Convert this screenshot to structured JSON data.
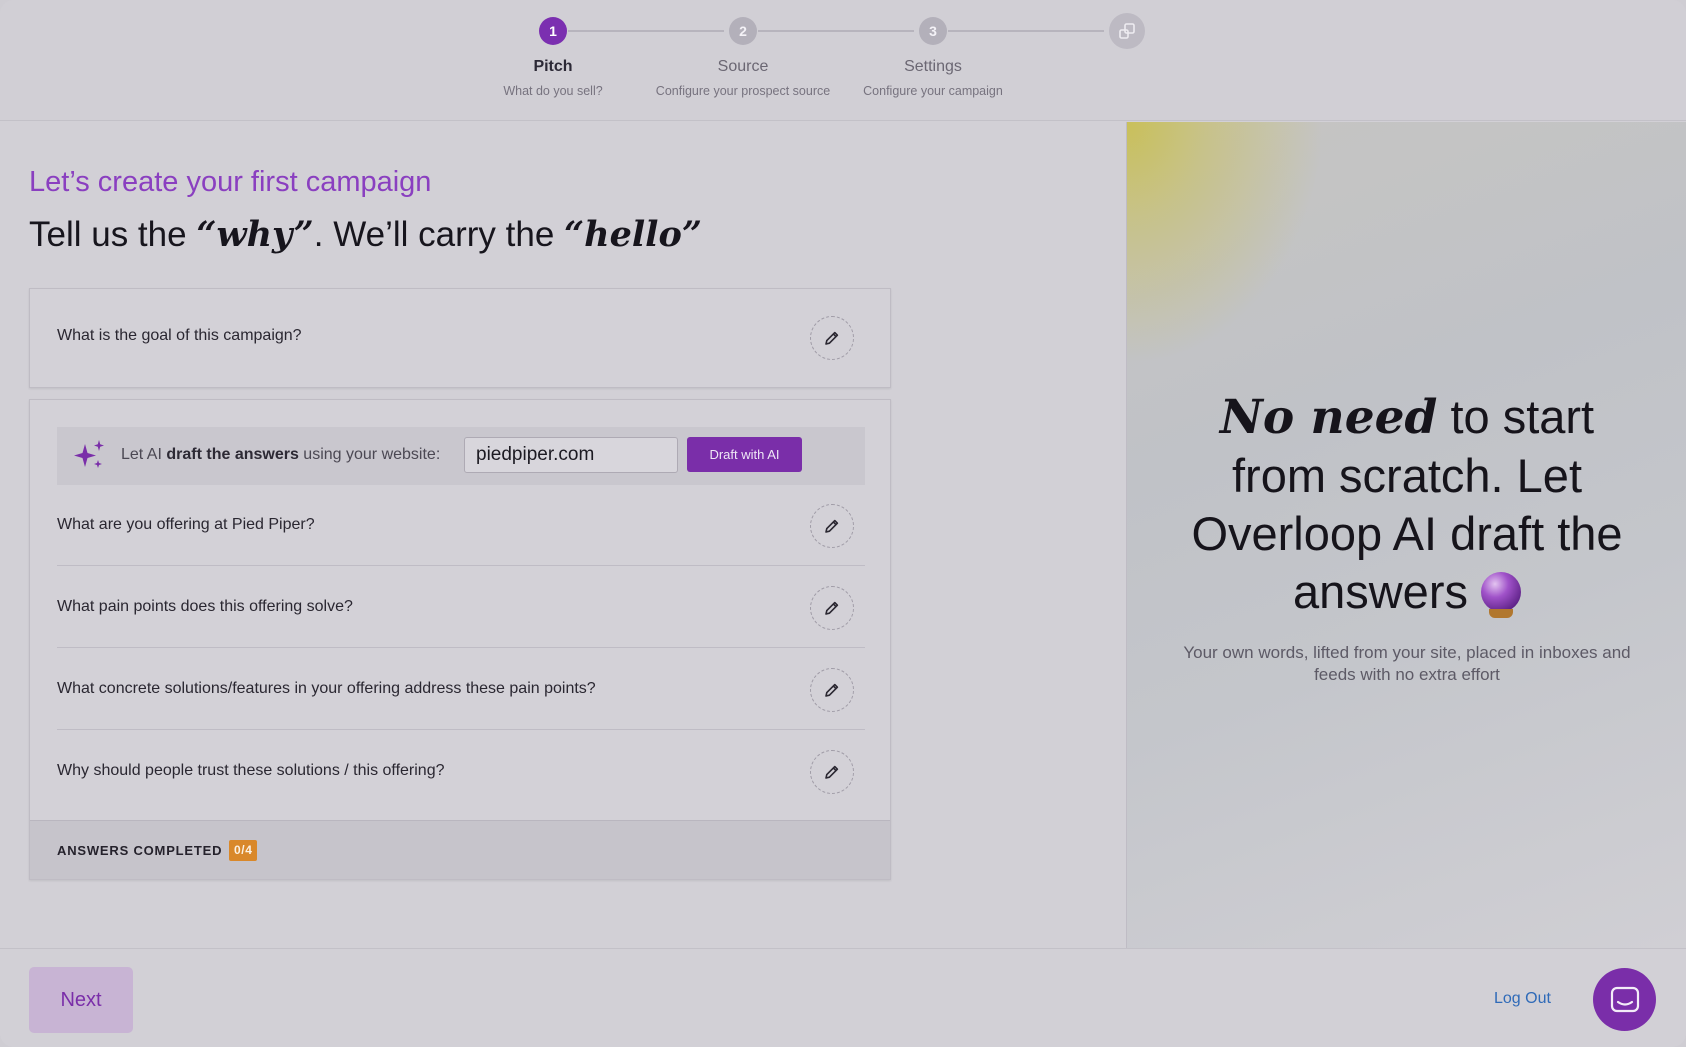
{
  "stepper": {
    "steps": [
      {
        "number": "1",
        "title": "Pitch",
        "subtitle": "What do you sell?",
        "active": true
      },
      {
        "number": "2",
        "title": "Source",
        "subtitle": "Configure your prospect source",
        "active": false
      },
      {
        "number": "3",
        "title": "Settings",
        "subtitle": "Configure your campaign",
        "active": false
      }
    ],
    "final_icon": "rocket-launch-icon"
  },
  "main": {
    "kicker": "Let’s create your first campaign",
    "headline": {
      "part1": "Tell us the ",
      "em1": "“why”",
      "part2": ". We’ll carry the ",
      "em2": "“hello”"
    },
    "goal_question": "What is the goal of this campaign?",
    "ai_bar": {
      "prefix": "Let AI ",
      "bold": "draft the answers",
      "suffix": " using your website:",
      "website_value": "piedpiper.com",
      "button": "Draft with AI",
      "icon": "sparkles-icon"
    },
    "questions": [
      "What are you offering at Pied Piper?",
      "What pain points does this offering solve?",
      "What concrete solutions/features in your offering address these pain points?",
      "Why should people trust these solutions / this offering?"
    ],
    "answers_label": "ANSWERS COMPLETED",
    "answers_count": "0/4"
  },
  "promo": {
    "title_em": "No need",
    "title_rest": " to start from scratch. Let Overloop AI draft the answers ",
    "subtitle": "Your own words, lifted from your site, placed in inboxes and feeds with no extra effort"
  },
  "footer": {
    "next": "Next",
    "logout": "Log Out"
  },
  "colors": {
    "accent": "#7a2ea9",
    "badge": "#d9882a",
    "link": "#2f6ab8"
  }
}
